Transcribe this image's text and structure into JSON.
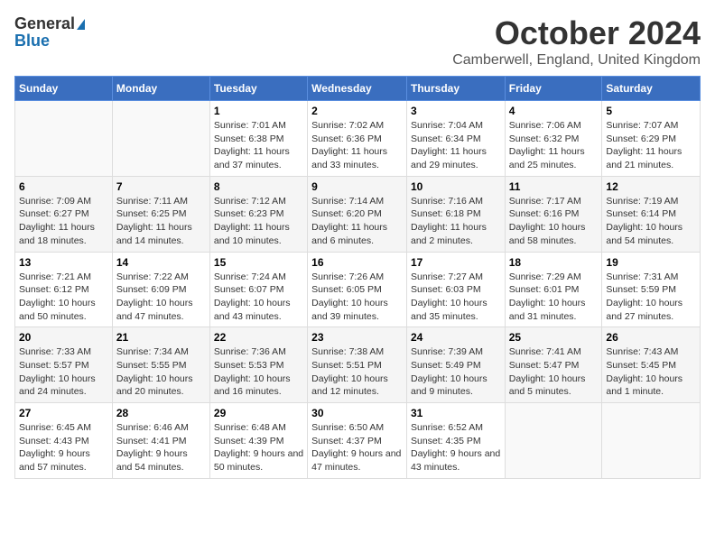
{
  "logo": {
    "general": "General",
    "blue": "Blue"
  },
  "title": "October 2024",
  "location": "Camberwell, England, United Kingdom",
  "days_of_week": [
    "Sunday",
    "Monday",
    "Tuesday",
    "Wednesday",
    "Thursday",
    "Friday",
    "Saturday"
  ],
  "weeks": [
    [
      {
        "day": "",
        "info": ""
      },
      {
        "day": "",
        "info": ""
      },
      {
        "day": "1",
        "info": "Sunrise: 7:01 AM\nSunset: 6:38 PM\nDaylight: 11 hours and 37 minutes."
      },
      {
        "day": "2",
        "info": "Sunrise: 7:02 AM\nSunset: 6:36 PM\nDaylight: 11 hours and 33 minutes."
      },
      {
        "day": "3",
        "info": "Sunrise: 7:04 AM\nSunset: 6:34 PM\nDaylight: 11 hours and 29 minutes."
      },
      {
        "day": "4",
        "info": "Sunrise: 7:06 AM\nSunset: 6:32 PM\nDaylight: 11 hours and 25 minutes."
      },
      {
        "day": "5",
        "info": "Sunrise: 7:07 AM\nSunset: 6:29 PM\nDaylight: 11 hours and 21 minutes."
      }
    ],
    [
      {
        "day": "6",
        "info": "Sunrise: 7:09 AM\nSunset: 6:27 PM\nDaylight: 11 hours and 18 minutes."
      },
      {
        "day": "7",
        "info": "Sunrise: 7:11 AM\nSunset: 6:25 PM\nDaylight: 11 hours and 14 minutes."
      },
      {
        "day": "8",
        "info": "Sunrise: 7:12 AM\nSunset: 6:23 PM\nDaylight: 11 hours and 10 minutes."
      },
      {
        "day": "9",
        "info": "Sunrise: 7:14 AM\nSunset: 6:20 PM\nDaylight: 11 hours and 6 minutes."
      },
      {
        "day": "10",
        "info": "Sunrise: 7:16 AM\nSunset: 6:18 PM\nDaylight: 11 hours and 2 minutes."
      },
      {
        "day": "11",
        "info": "Sunrise: 7:17 AM\nSunset: 6:16 PM\nDaylight: 10 hours and 58 minutes."
      },
      {
        "day": "12",
        "info": "Sunrise: 7:19 AM\nSunset: 6:14 PM\nDaylight: 10 hours and 54 minutes."
      }
    ],
    [
      {
        "day": "13",
        "info": "Sunrise: 7:21 AM\nSunset: 6:12 PM\nDaylight: 10 hours and 50 minutes."
      },
      {
        "day": "14",
        "info": "Sunrise: 7:22 AM\nSunset: 6:09 PM\nDaylight: 10 hours and 47 minutes."
      },
      {
        "day": "15",
        "info": "Sunrise: 7:24 AM\nSunset: 6:07 PM\nDaylight: 10 hours and 43 minutes."
      },
      {
        "day": "16",
        "info": "Sunrise: 7:26 AM\nSunset: 6:05 PM\nDaylight: 10 hours and 39 minutes."
      },
      {
        "day": "17",
        "info": "Sunrise: 7:27 AM\nSunset: 6:03 PM\nDaylight: 10 hours and 35 minutes."
      },
      {
        "day": "18",
        "info": "Sunrise: 7:29 AM\nSunset: 6:01 PM\nDaylight: 10 hours and 31 minutes."
      },
      {
        "day": "19",
        "info": "Sunrise: 7:31 AM\nSunset: 5:59 PM\nDaylight: 10 hours and 27 minutes."
      }
    ],
    [
      {
        "day": "20",
        "info": "Sunrise: 7:33 AM\nSunset: 5:57 PM\nDaylight: 10 hours and 24 minutes."
      },
      {
        "day": "21",
        "info": "Sunrise: 7:34 AM\nSunset: 5:55 PM\nDaylight: 10 hours and 20 minutes."
      },
      {
        "day": "22",
        "info": "Sunrise: 7:36 AM\nSunset: 5:53 PM\nDaylight: 10 hours and 16 minutes."
      },
      {
        "day": "23",
        "info": "Sunrise: 7:38 AM\nSunset: 5:51 PM\nDaylight: 10 hours and 12 minutes."
      },
      {
        "day": "24",
        "info": "Sunrise: 7:39 AM\nSunset: 5:49 PM\nDaylight: 10 hours and 9 minutes."
      },
      {
        "day": "25",
        "info": "Sunrise: 7:41 AM\nSunset: 5:47 PM\nDaylight: 10 hours and 5 minutes."
      },
      {
        "day": "26",
        "info": "Sunrise: 7:43 AM\nSunset: 5:45 PM\nDaylight: 10 hours and 1 minute."
      }
    ],
    [
      {
        "day": "27",
        "info": "Sunrise: 6:45 AM\nSunset: 4:43 PM\nDaylight: 9 hours and 57 minutes."
      },
      {
        "day": "28",
        "info": "Sunrise: 6:46 AM\nSunset: 4:41 PM\nDaylight: 9 hours and 54 minutes."
      },
      {
        "day": "29",
        "info": "Sunrise: 6:48 AM\nSunset: 4:39 PM\nDaylight: 9 hours and 50 minutes."
      },
      {
        "day": "30",
        "info": "Sunrise: 6:50 AM\nSunset: 4:37 PM\nDaylight: 9 hours and 47 minutes."
      },
      {
        "day": "31",
        "info": "Sunrise: 6:52 AM\nSunset: 4:35 PM\nDaylight: 9 hours and 43 minutes."
      },
      {
        "day": "",
        "info": ""
      },
      {
        "day": "",
        "info": ""
      }
    ]
  ]
}
